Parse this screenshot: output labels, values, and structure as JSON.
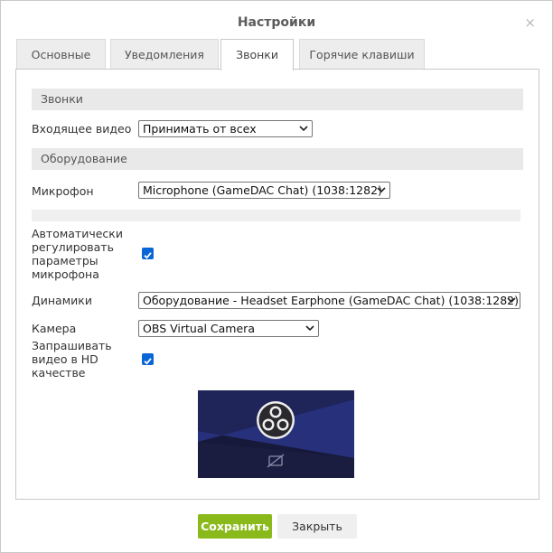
{
  "dialog": {
    "title": "Настройки",
    "close_symbol": "×"
  },
  "tabs": [
    {
      "label": "Основные",
      "active": false
    },
    {
      "label": "Уведомления",
      "active": false
    },
    {
      "label": "Звонки",
      "active": true
    },
    {
      "label": "Горячие клавиши",
      "active": false
    }
  ],
  "calls_section": {
    "title": "Звонки",
    "incoming_video": {
      "label": "Входящее видео",
      "value": "Принимать от всех"
    }
  },
  "hardware_section": {
    "title": "Оборудование",
    "microphone": {
      "label": "Микрофон",
      "value": "Microphone (GameDAC Chat) (1038:1282)"
    },
    "auto_gain": {
      "label_lines": [
        "Автоматически",
        "регулировать",
        "параметры",
        "микрофона"
      ],
      "checked": true
    },
    "speakers": {
      "label": "Динамики",
      "value": "Оборудование - Headset Earphone (GameDAC Chat) (1038:1282)"
    },
    "camera": {
      "label": "Камера",
      "value": "OBS Virtual Camera"
    },
    "hd_video": {
      "label_lines": [
        "Запрашивать",
        "видео в HD",
        "качестве"
      ],
      "checked": true
    }
  },
  "buttons": {
    "save": "Сохранить",
    "close": "Закрыть"
  },
  "colors": {
    "accent_green": "#8ab91b",
    "checkbox_blue": "#0a66d6",
    "section_bg": "#e9e9e9"
  },
  "icons": {
    "camera_preview": "obs-logo-icon",
    "camera_off": "camera-off-icon",
    "dropdown": "chevron-down-icon"
  }
}
